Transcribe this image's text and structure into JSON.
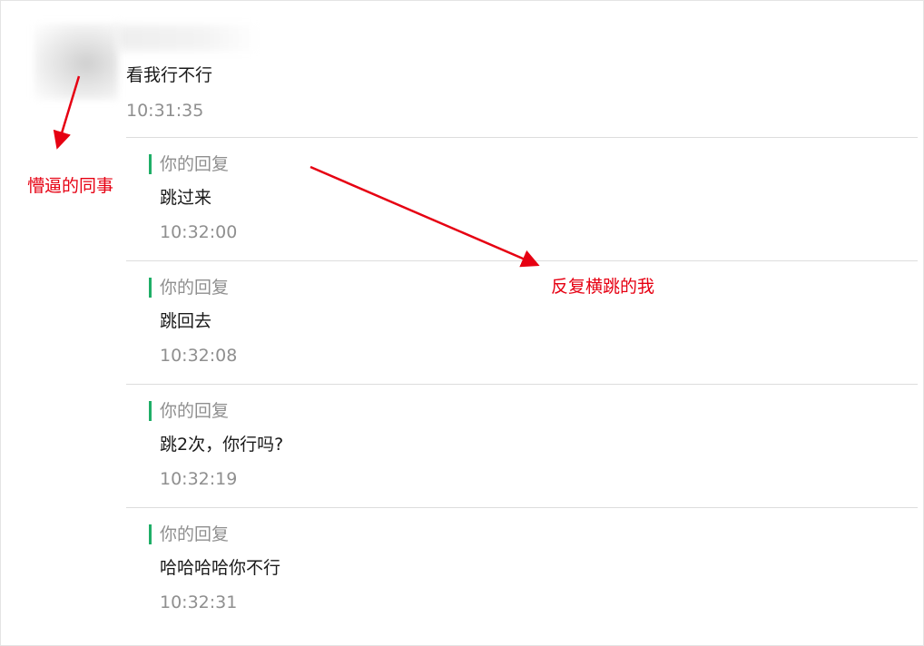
{
  "original_message": {
    "text": "看我行不行",
    "time": "10:31:35"
  },
  "replies": [
    {
      "label": "你的回复",
      "text": "跳过来",
      "time": "10:32:00"
    },
    {
      "label": "你的回复",
      "text": "跳回去",
      "time": "10:32:08"
    },
    {
      "label": "你的回复",
      "text": "跳2次，你行吗?",
      "time": "10:32:19"
    },
    {
      "label": "你的回复",
      "text": "哈哈哈哈你不行",
      "time": "10:32:31"
    }
  ],
  "annotations": {
    "colleague": "懵逼的同事",
    "me": "反复横跳的我"
  },
  "colors": {
    "annotation": "#e60012",
    "reply_accent": "#1fae67",
    "time_text": "#8f8f8f"
  }
}
